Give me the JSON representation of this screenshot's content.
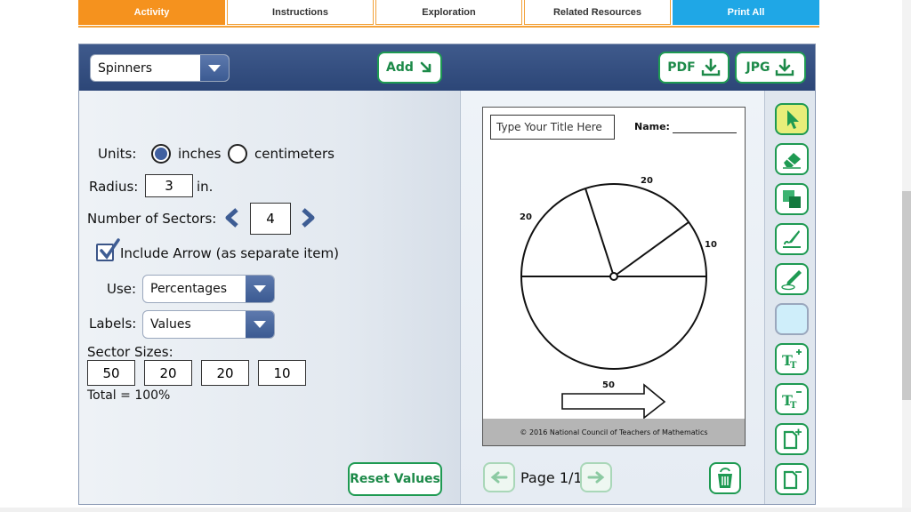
{
  "tabs": [
    {
      "label": "Activity",
      "active": true
    },
    {
      "label": "Instructions"
    },
    {
      "label": "Exploration"
    },
    {
      "label": "Related Resources"
    },
    {
      "label": "Print All"
    }
  ],
  "header": {
    "item_select": "Spinners",
    "add_label": "Add",
    "pdf_label": "PDF",
    "jpg_label": "JPG"
  },
  "settings": {
    "units_label": "Units:",
    "unit_inches": "inches",
    "unit_centimeters": "centimeters",
    "selected_unit": "inches",
    "radius_label": "Radius:",
    "radius_value": "3",
    "radius_unit": "in.",
    "sectors_label": "Number of Sectors:",
    "sectors_value": "4",
    "include_arrow_label": "Include Arrow (as separate item)",
    "include_arrow_checked": true,
    "use_label": "Use:",
    "use_value": "Percentages",
    "labels_label": "Labels:",
    "labels_value": "Values",
    "sector_sizes_label": "Sector Sizes:",
    "sector_sizes": [
      "50",
      "20",
      "20",
      "10"
    ],
    "total_text": "Total = 100%",
    "reset_label": "Reset Values"
  },
  "preview": {
    "title_placeholder": "Type Your Title Here",
    "name_label": "Name:",
    "sector_labels": [
      "20",
      "20",
      "10"
    ],
    "arrow_label": "50",
    "copyright": "© 2016 National Council of Teachers of Mathematics",
    "page_indicator": "Page 1/1"
  },
  "tools": [
    "pointer-icon",
    "eraser-icon",
    "layers-icon",
    "paint-brush-icon",
    "pen-icon",
    "fill-color-swatch",
    "text-larger-icon",
    "text-smaller-icon",
    "add-page-icon",
    "remove-page-icon"
  ],
  "colors": {
    "accent_green": "#1e9a52",
    "header_blue": "#34507f",
    "tab_orange": "#f5921e",
    "tab_blue": "#1fa7e6",
    "pointer_highlight": "#e8ee7a",
    "swatch_fill": "#cfeefa"
  }
}
